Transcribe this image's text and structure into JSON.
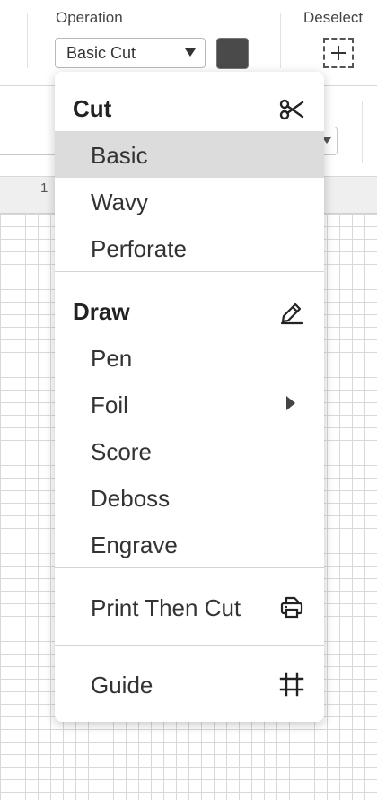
{
  "toolbar": {
    "operation_label": "Operation",
    "operation_value": "Basic Cut",
    "deselect_label": "Deselect",
    "swatch_color": "#4a4a4a"
  },
  "ruler": {
    "tick_label": "1"
  },
  "menu": {
    "cut_header": "Cut",
    "cut_items": [
      "Basic",
      "Wavy",
      "Perforate"
    ],
    "selected_item": "Basic",
    "draw_header": "Draw",
    "draw_items": [
      "Pen",
      "Foil",
      "Score",
      "Deboss",
      "Engrave"
    ],
    "print_then_cut": "Print Then Cut",
    "guide": "Guide"
  },
  "icons": {
    "cut": "scissors-icon",
    "draw": "pen-icon",
    "foil_submenu": "chevron-right-icon",
    "print_then_cut": "printer-icon",
    "guide": "guide-frame-icon",
    "deselect": "dashed-plus-icon"
  }
}
